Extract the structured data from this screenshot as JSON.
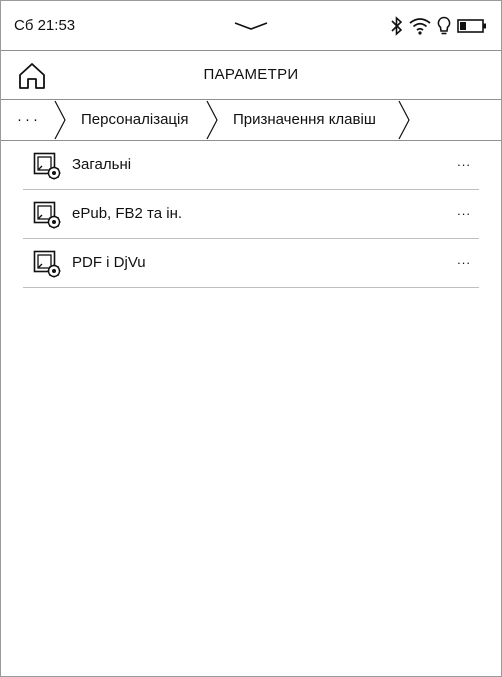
{
  "status_bar": {
    "time": "Сб 21:53",
    "icons": [
      "pull-down-handle",
      "bluetooth-icon",
      "wifi-icon",
      "frontlight-bulb-icon",
      "battery-icon"
    ]
  },
  "header": {
    "title": "ПАРАМЕТРИ",
    "home_icon": "home-icon"
  },
  "breadcrumb": {
    "overflow": "···",
    "items": [
      {
        "label": "Персоналізація"
      },
      {
        "label": "Призначення клавіш"
      }
    ]
  },
  "list": {
    "items": [
      {
        "label": "Загальні",
        "more": "...",
        "icon": "settings-page-icon"
      },
      {
        "label": "ePub, FB2 та ін.",
        "more": "...",
        "icon": "settings-page-icon"
      },
      {
        "label": "PDF і DjVu",
        "more": "...",
        "icon": "settings-page-icon"
      }
    ]
  }
}
